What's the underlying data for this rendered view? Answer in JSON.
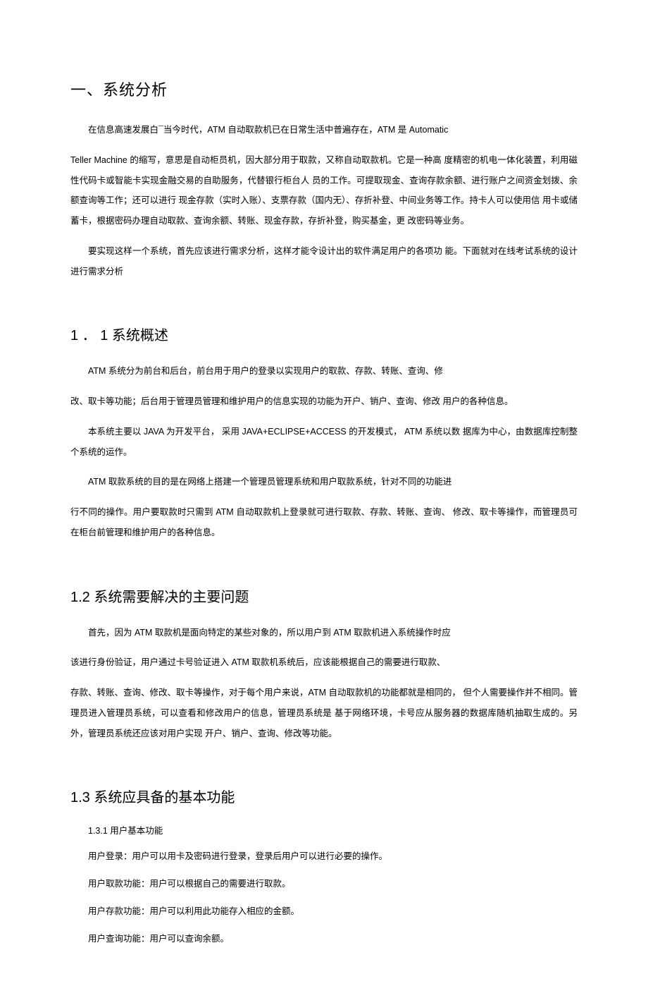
{
  "section1": {
    "title": "一、系统分析",
    "para1": "在信息高速发展白¯当今时代，ATM 自动取款机已在日常生活中普遍存在，ATM 是 Automatic",
    "para2": "Teller Machine 的缩写，意思是自动柜员机，因大部分用于取款，又称自动取款机。它是一种高 度精密的机电一体化装置，利用磁性代码卡或智能卡实现金融交易的自助服务，代替银行柜台人 员的工作。可提取现金、查询存款余额、进行账户之间资金划拨、余额查询等工作；还可以进行 现金存款（实时入账）、支票存款（国内无）、存折补登、中间业务等工作。持卡人可以使用信 用卡或储蓄卡，根据密码办理自动取款、查询余额、转账、现金存款，存折补登，购买基金，更 改密码等业务。",
    "para3": "要实现这样一个系统，首先应该进行需求分析，这样才能令设计出的软件满足用户的各项功 能。下面就对在线考试系统的设计进行需求分析"
  },
  "section2": {
    "title": "1 ． 1 系统概述",
    "para1": "ATM 系统分为前台和后台，前台用于用户的登录以实现用户的取款、存款、转账、查询、修",
    "para2": "改、取卡等功能；后台用于管理员管理和维护用户的信息实现的功能为开户、销户、查询、修改 用户的各种信息。",
    "para3": "本系统主要以 JAVA 为开发平台， 采用 JAVA+ECLIPSE+ACCESS 的开发模式， ATM 系统以数 据库为中心，由数据库控制整个系统的运作。",
    "para4": "ATM 取款系统的目的是在网络上搭建一个管理员管理系统和用户取款系统，针对不同的功能进",
    "para5": "行不同的操作。用户要取款时只需到 ATM 自动取款机上登录就可进行取款、存款、转账、查询、 修改、取卡等操作，而管理员可在柜台前管理和维护用户的各种信息。"
  },
  "section3": {
    "title": "1.2   系统需要解决的主要问题",
    "para1": "首先，因为 ATM 取款机是面向特定的某些对象的，所以用户到 ATM 取款机进入系统操作时应",
    "para2": "该进行身份验证，用户通过卡号验证进入 ATM 取款机系统后，应该能根据自己的需要进行取款、",
    "para3": "存款、转账、查询、修改、取卡等操作，对于每个用户来说，ATM 自动取款机的功能都就是相同的， 但个人需要操作并不相同。管理员进入管理员系统，可以查看和修改用户的信息，管理员系统是 基于网络环境，卡号应从服务器的数据库随机抽取生成的。另外，管理员系统还应该对用户实现 开户、销户、查询、修改等功能。"
  },
  "section4": {
    "title": "1.3   系统应具备的基本功能",
    "subsection": "1.3.1    用户基本功能",
    "feature1": "用户登录：用户可以用卡及密码进行登录，登录后用户可以进行必要的操作。",
    "feature2": "用户取款功能：用户可以根据自己的需要进行取款。",
    "feature3": "用户存款功能：用户可以利用此功能存入相应的金额。",
    "feature4": "用户查询功能：用户可以查询余额。"
  }
}
